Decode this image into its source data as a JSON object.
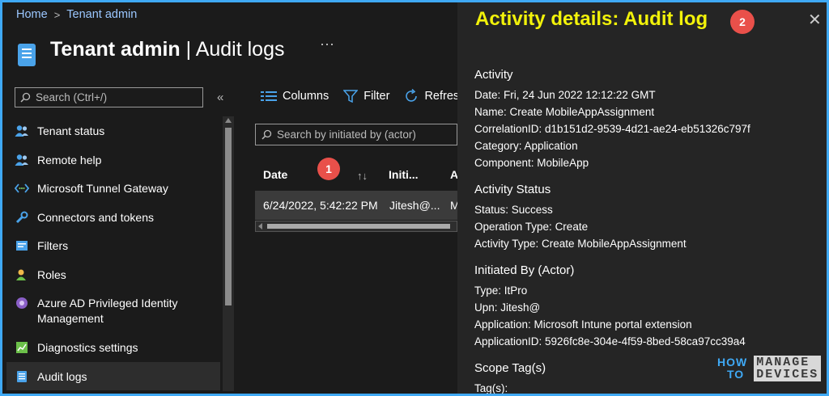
{
  "breadcrumb": {
    "home": "Home",
    "separator": ">",
    "current": "Tenant admin"
  },
  "header": {
    "title_main": "Tenant admin",
    "title_sep": " | ",
    "title_sub": "Audit logs",
    "more": "···"
  },
  "sidebar": {
    "search_placeholder": "Search (Ctrl+/)",
    "collapse": "«",
    "items": [
      {
        "label": "Tenant status",
        "icon": "people-icon"
      },
      {
        "label": "Remote help",
        "icon": "people-icon"
      },
      {
        "label": "Microsoft Tunnel Gateway",
        "icon": "tunnel-icon"
      },
      {
        "label": "Connectors and tokens",
        "icon": "wrench-icon"
      },
      {
        "label": "Filters",
        "icon": "filter-icon"
      },
      {
        "label": "Roles",
        "icon": "person-icon"
      },
      {
        "label": "Azure AD Privileged Identity Management",
        "icon": "shield-icon"
      },
      {
        "label": "Diagnostics settings",
        "icon": "chart-icon"
      },
      {
        "label": "Audit logs",
        "icon": "log-icon",
        "active": true
      }
    ]
  },
  "toolbar": {
    "columns": "Columns",
    "filter": "Filter",
    "refresh": "Refres"
  },
  "table": {
    "search_placeholder": "Search by initiated by (actor)",
    "headers": {
      "date": "Date",
      "initiated": "Initi...",
      "a": "A"
    },
    "rows": [
      {
        "date": "6/24/2022, 5:42:22 PM",
        "initiated": "Jitesh@...",
        "a": "M"
      }
    ]
  },
  "badges": {
    "one": "1",
    "two": "2"
  },
  "panel": {
    "title": "Activity details: Audit log",
    "close": "✕",
    "activity": {
      "heading": "Activity",
      "date": "Date: Fri, 24 Jun 2022 12:12:22 GMT",
      "name": "Name: Create MobileAppAssignment",
      "correlation": "CorrelationID: d1b151d2-9539-4d21-ae24-eb51326c797f",
      "category": "Category: Application",
      "component": "Component: MobileApp"
    },
    "status": {
      "heading": "Activity Status",
      "status": "Status: Success",
      "operation": "Operation Type: Create",
      "activity_type": "Activity Type: Create MobileAppAssignment"
    },
    "initiated": {
      "heading": "Initiated By (Actor)",
      "type": "Type: ItPro",
      "upn": "Upn: Jitesh@",
      "application": "Application: Microsoft Intune portal extension",
      "application_id": "ApplicationID: 5926fc8e-304e-4f59-8bed-58ca97cc39a4"
    },
    "scope": {
      "heading": "Scope Tag(s)",
      "tags": "Tag(s):"
    }
  },
  "logo": {
    "how": "HOW",
    "to": "TO",
    "manage": "MANAGE",
    "devices": "DEVICES"
  },
  "colors": {
    "accent": "#3fa9f5",
    "title_yellow": "#f2f20a",
    "badge_red": "#e9504a"
  }
}
